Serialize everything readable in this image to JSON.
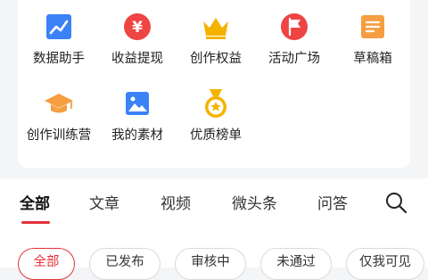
{
  "tools": [
    {
      "label": "数据助手",
      "icon": "chart-trend-icon",
      "color": "#3b82f6"
    },
    {
      "label": "收益提现",
      "icon": "yen-coin-icon",
      "color": "#ef4444"
    },
    {
      "label": "创作权益",
      "icon": "crown-icon",
      "color": "#f5b301"
    },
    {
      "label": "活动广场",
      "icon": "flag-icon",
      "color": "#ef4444"
    },
    {
      "label": "草稿箱",
      "icon": "draft-box-icon",
      "color": "#f59e42"
    },
    {
      "label": "创作训练营",
      "icon": "graduation-cap-icon",
      "color": "#f59e42"
    },
    {
      "label": "我的素材",
      "icon": "image-icon",
      "color": "#3b82f6"
    },
    {
      "label": "优质榜单",
      "icon": "medal-icon",
      "color": "#f5b301"
    }
  ],
  "tabs": [
    "全部",
    "文章",
    "视频",
    "微头条",
    "问答"
  ],
  "filters": [
    "全部",
    "已发布",
    "审核中",
    "未通过",
    "仅我可见"
  ],
  "accent": "#e5313a"
}
